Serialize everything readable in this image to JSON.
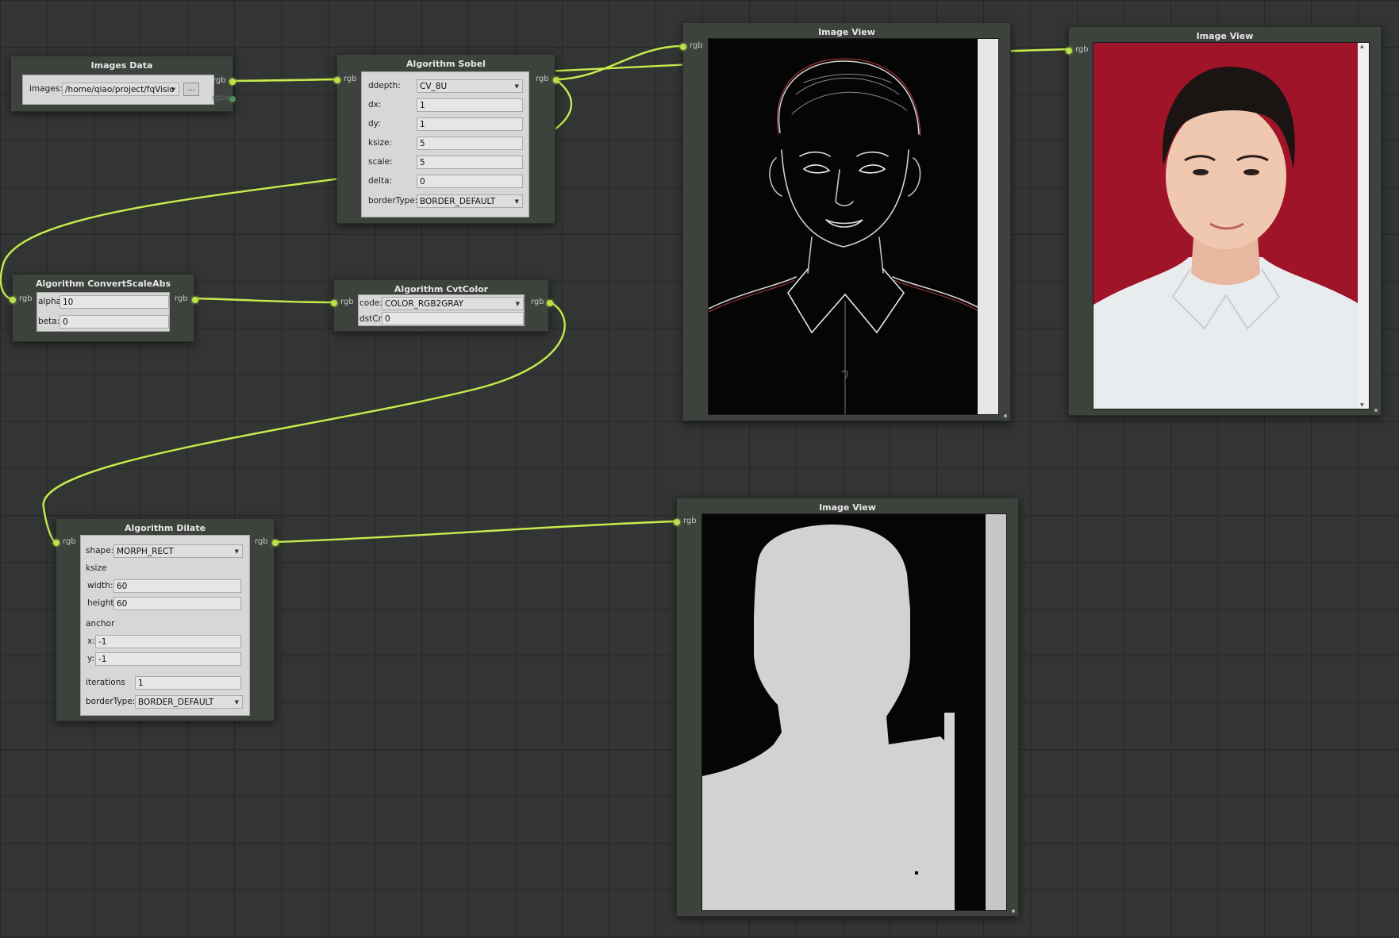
{
  "colors": {
    "wire": "#c6ec4c",
    "port": "#b9e14a",
    "background": "#333534"
  },
  "images_data": {
    "title": "Images Data",
    "images_label": "images:",
    "images_value": "/home/qiao/project/fqVisio",
    "browse_label": "...",
    "out_rgb": "rgb",
    "out_rgba": "rgba"
  },
  "sobel": {
    "title": "Algorithm Sobel",
    "in_label": "rgb",
    "out_label": "rgb",
    "fields": [
      {
        "label": "ddepth:",
        "value": "CV_8U",
        "type": "combo"
      },
      {
        "label": "dx:",
        "value": "1",
        "type": "text"
      },
      {
        "label": "dy:",
        "value": "1",
        "type": "text"
      },
      {
        "label": "ksize:",
        "value": "5",
        "type": "text"
      },
      {
        "label": "scale:",
        "value": "5",
        "type": "text"
      },
      {
        "label": "delta:",
        "value": "0",
        "type": "text"
      },
      {
        "label": "borderType:",
        "value": "BORDER_DEFAULT",
        "type": "combo"
      }
    ]
  },
  "convert_scale_abs": {
    "title": "Algorithm ConvertScaleAbs",
    "in_label": "rgb",
    "out_label": "rgb",
    "fields": [
      {
        "label": "alpha:",
        "value": "10"
      },
      {
        "label": "beta:",
        "value": "0"
      }
    ]
  },
  "cvt_color": {
    "title": "Algorithm CvtColor",
    "in_label": "rgb",
    "out_label": "rgb",
    "code_label": "code:",
    "code_value": "COLOR_RGB2GRAY",
    "dstcn_label": "dstCn:",
    "dstcn_value": "0"
  },
  "dilate": {
    "title": "Algorithm Dilate",
    "in_label": "rgb",
    "out_label": "rgb",
    "shape_label": "shape:",
    "shape_value": "MORPH_RECT",
    "ksize_label": "ksize",
    "width_label": "width:",
    "width_value": "60",
    "height_label": "height:",
    "height_value": "60",
    "anchor_label": "anchor",
    "x_label": "x:",
    "x_value": "-1",
    "y_label": "y:",
    "y_value": "-1",
    "iterations_label": "iterations",
    "iterations_value": "1",
    "bordertype_label": "borderType:",
    "bordertype_value": "BORDER_DEFAULT"
  },
  "image_view_sobel": {
    "title": "Image View",
    "in_label": "rgb"
  },
  "image_view_original": {
    "title": "Image View",
    "in_label": "rgb"
  },
  "image_view_dilate": {
    "title": "Image View",
    "in_label": "rgb"
  }
}
